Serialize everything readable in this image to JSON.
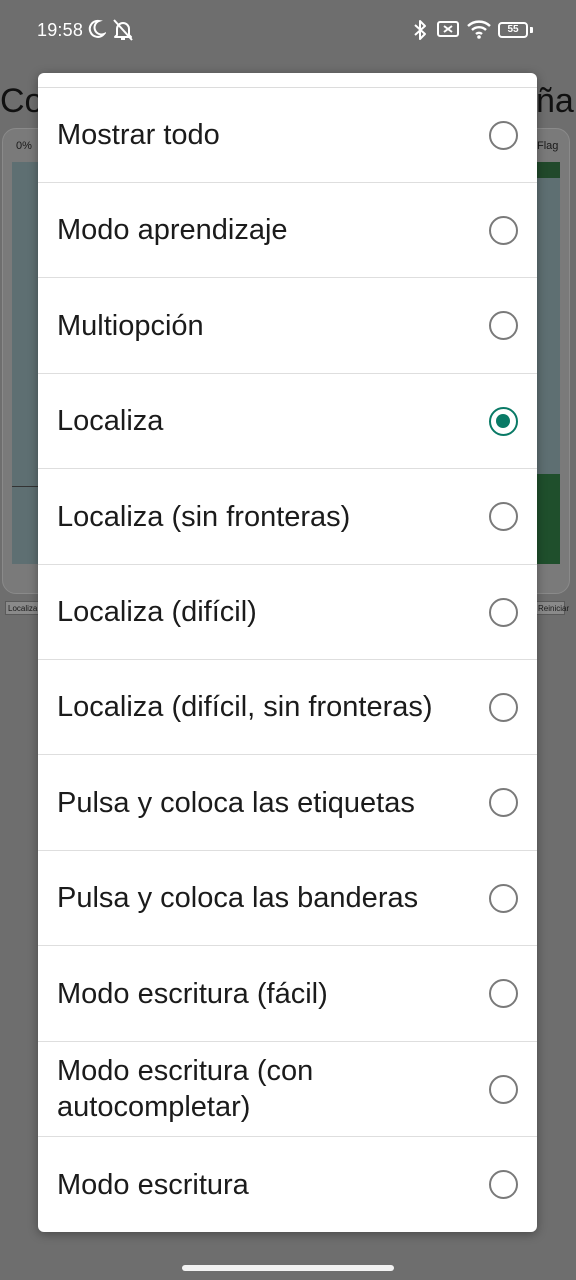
{
  "status_bar": {
    "time": "19:58",
    "battery": "55",
    "icons": [
      "moon-icon",
      "bell-off-icon",
      "bluetooth-icon",
      "sim-x-icon",
      "wifi-icon",
      "battery-icon"
    ]
  },
  "background_app": {
    "title_left": "Co",
    "title_right": "ña",
    "progress_label": "0%",
    "flag_label": "Flag",
    "left_button": "Localiza",
    "right_button": "Reiniciar"
  },
  "dialog": {
    "options": [
      {
        "label": "Mostrar todo",
        "selected": false
      },
      {
        "label": "Modo aprendizaje",
        "selected": false
      },
      {
        "label": "Multiopción",
        "selected": false
      },
      {
        "label": "Localiza",
        "selected": true
      },
      {
        "label": "Localiza (sin fronteras)",
        "selected": false
      },
      {
        "label": "Localiza (difícil)",
        "selected": false
      },
      {
        "label": "Localiza (difícil, sin fronteras)",
        "selected": false
      },
      {
        "label": "Pulsa y coloca las etiquetas",
        "selected": false
      },
      {
        "label": "Pulsa y coloca las banderas",
        "selected": false
      },
      {
        "label": "Modo escritura (fácil)",
        "selected": false
      },
      {
        "label": "Modo escritura (con autocompletar)",
        "selected": false
      },
      {
        "label": "Modo escritura",
        "selected": false
      }
    ]
  },
  "colors": {
    "accent": "#0a7a66",
    "scrim": "#6e6e6e"
  }
}
